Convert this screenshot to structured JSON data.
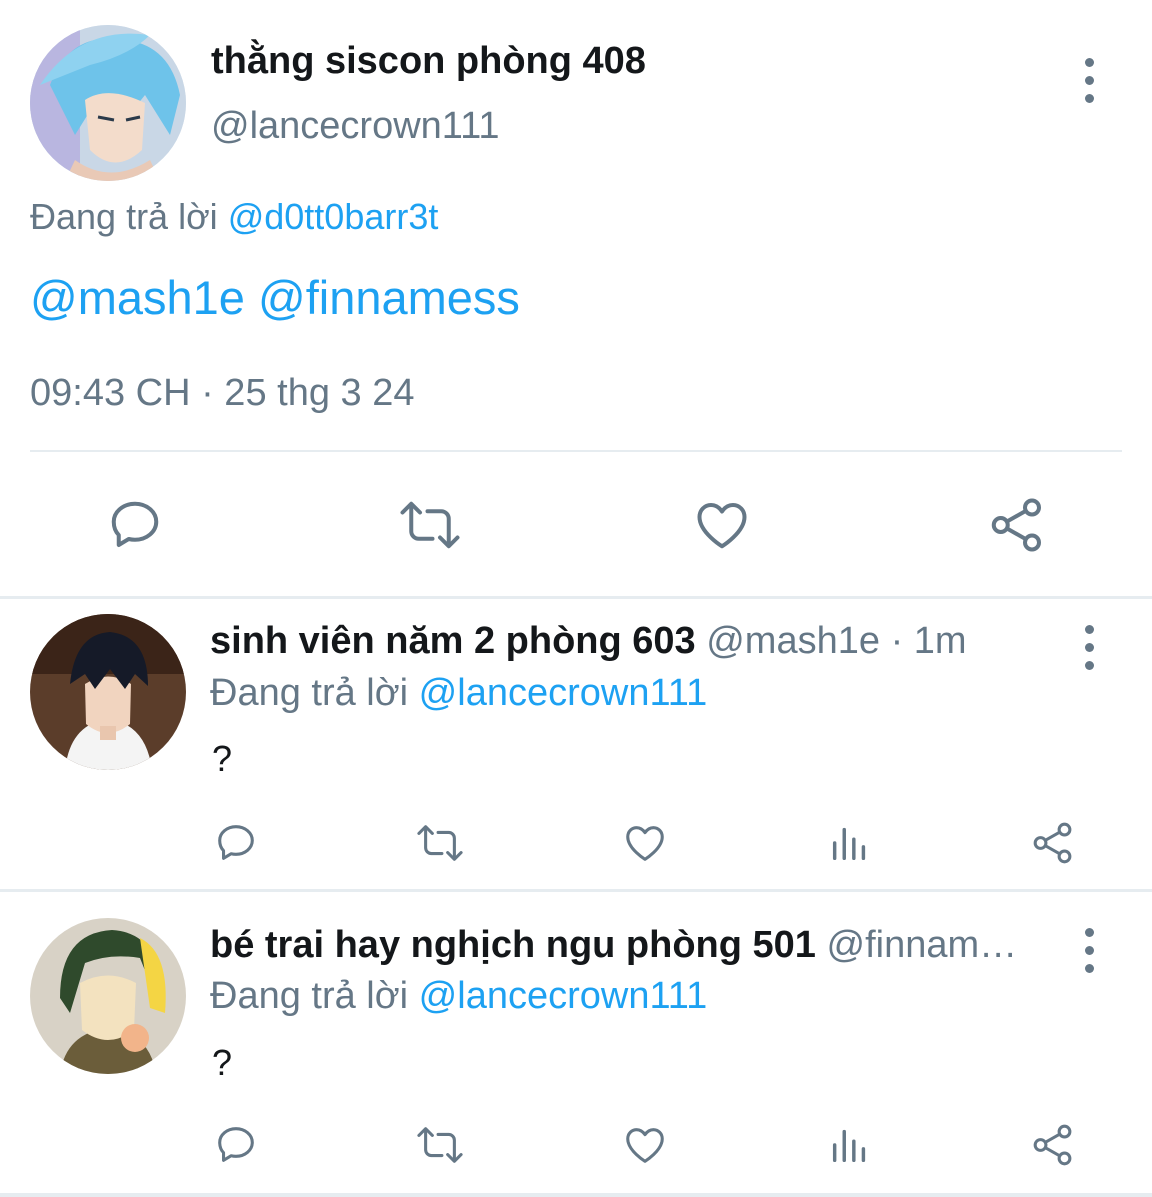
{
  "main_tweet": {
    "display_name": "thằng siscon phòng 408",
    "handle": "@lancecrown111",
    "replying_label": "Đang trả lời",
    "replying_to": "@d0tt0barr3t",
    "mentions": [
      "@mash1e",
      "@finnamess"
    ],
    "timestamp": "09:43 CH · 25 thg 3 24",
    "actions": [
      "reply-icon",
      "retweet-icon",
      "like-icon",
      "share-icon"
    ]
  },
  "replies": [
    {
      "display_name": "sinh viên năm 2 phòng 603",
      "handle": "@mash1e",
      "time": "· 1m",
      "replying_label": "Đang trả lời",
      "replying_to": "@lancecrown111",
      "text": "?"
    },
    {
      "display_name": "bé trai hay nghịch ngu phòng 501",
      "handle": "@finnam…",
      "time": "",
      "replying_label": "Đang trả lời",
      "replying_to": "@lancecrown111",
      "text": "?"
    }
  ],
  "colors": {
    "link": "#1da1f2",
    "secondary": "#657786",
    "text": "#14171a",
    "divider": "#e6ecf0"
  }
}
